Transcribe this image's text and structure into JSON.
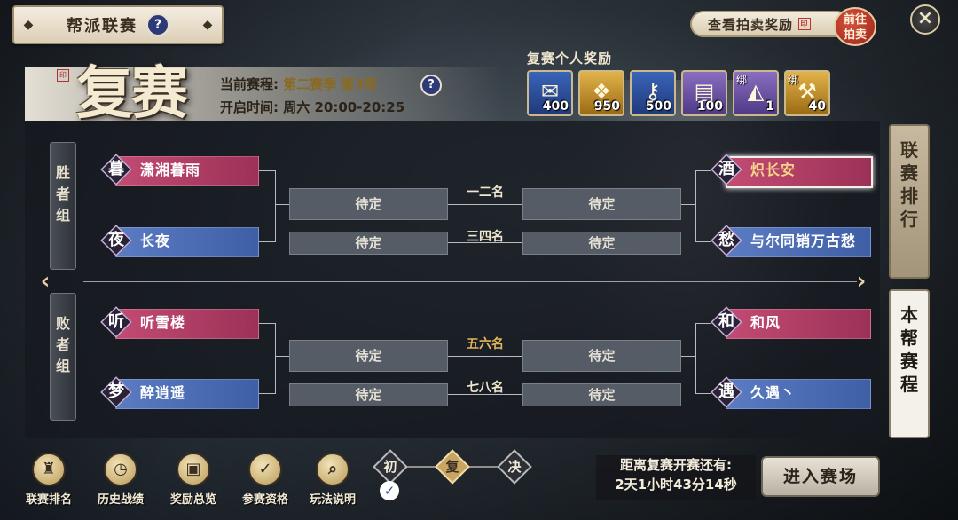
{
  "header": {
    "title": "帮派联赛",
    "help": "?"
  },
  "auction": {
    "label": "查看拍卖奖励",
    "goto_line1": "前往",
    "goto_line2": "拍卖"
  },
  "close_icon": "×",
  "stage": {
    "big_title": "复赛",
    "schedule_label": "当前赛程:",
    "schedule_value": "第二赛季 第3周",
    "open_label": "开启时间:",
    "open_value": "周六 20:00-20:25"
  },
  "rewards": {
    "title": "复赛个人奖励",
    "items": [
      {
        "count": "400",
        "bound": "",
        "icon": "red-packet-icon",
        "color": "blue"
      },
      {
        "count": "950",
        "bound": "",
        "icon": "gold-token-icon",
        "color": "gold"
      },
      {
        "count": "500",
        "bound": "",
        "icon": "gold-key-icon",
        "color": "blue"
      },
      {
        "count": "100",
        "bound": "",
        "icon": "scroll-icon",
        "color": "purple"
      },
      {
        "count": "1",
        "bound": "绑",
        "icon": "fan-icon",
        "color": "purple"
      },
      {
        "count": "40",
        "bound": "绑",
        "icon": "hammer-icon",
        "color": "gold"
      }
    ]
  },
  "groups": {
    "winners": "胜者组",
    "losers": "败者组"
  },
  "bracket": {
    "winners_left": [
      {
        "emblem": "暮",
        "name": "潇湘暮雨",
        "color": "pink"
      },
      {
        "emblem": "夜",
        "name": "长夜",
        "color": "blue"
      }
    ],
    "winners_right": [
      {
        "emblem": "酒",
        "name": "炽长安",
        "color": "pink"
      },
      {
        "emblem": "愁",
        "name": "与尔同销万古愁",
        "color": "blue"
      }
    ],
    "losers_left": [
      {
        "emblem": "听",
        "name": "听雪楼",
        "color": "pink"
      },
      {
        "emblem": "梦",
        "name": "醉逍遥",
        "color": "blue"
      }
    ],
    "losers_right": [
      {
        "emblem": "和",
        "name": "和风",
        "color": "pink"
      },
      {
        "emblem": "遇",
        "name": "久遇丶",
        "color": "blue"
      }
    ],
    "tbd": "待定",
    "rank_1_2": "一二名",
    "rank_3_4": "三四名",
    "rank_5_6": "五六名",
    "rank_7_8": "七八名"
  },
  "side_tabs": {
    "league_rank": "联赛排行",
    "guild_schedule": "本帮赛程"
  },
  "nav": [
    {
      "label": "联赛排名",
      "icon": "trophy-icon"
    },
    {
      "label": "历史战绩",
      "icon": "clock-icon"
    },
    {
      "label": "奖励总览",
      "icon": "gift-icon"
    },
    {
      "label": "参赛资格",
      "icon": "check-badge-icon"
    },
    {
      "label": "玩法说明",
      "icon": "doc-search-icon"
    }
  ],
  "stages": {
    "first": "初",
    "second": "复",
    "final": "决"
  },
  "countdown": {
    "label": "距离复赛开赛还有:",
    "value": "2天1小时43分14秒"
  },
  "enter_button": "进入赛场"
}
